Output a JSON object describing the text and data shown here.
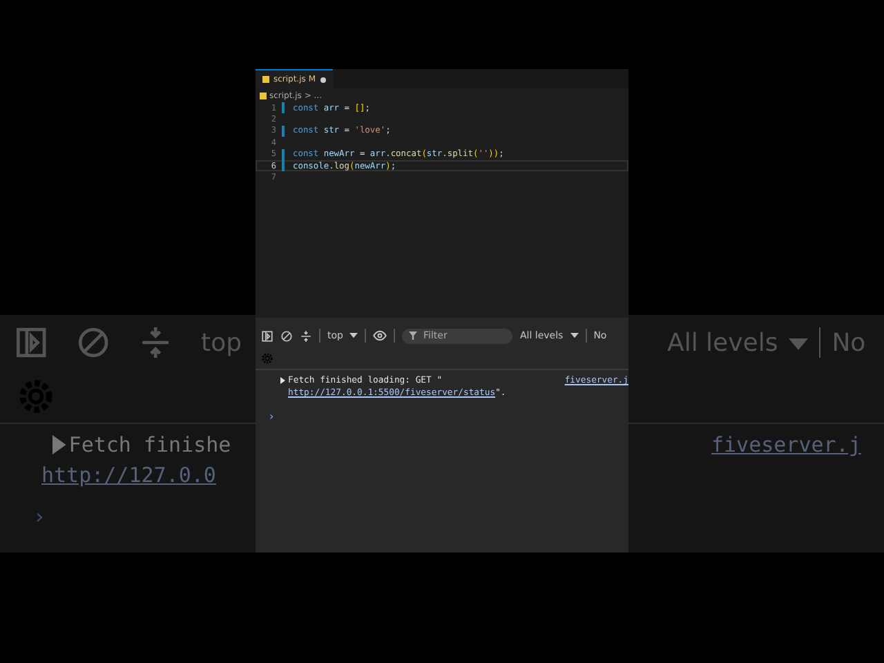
{
  "backdrop": {
    "left": {
      "context": "top",
      "message": "Fetch finishe",
      "url": "http://127.0.0",
      "prompt": "›"
    },
    "right": {
      "levels": "All levels",
      "issues": "No",
      "source": "fiveserver.j"
    }
  },
  "editor": {
    "tab": {
      "filename": "script.js",
      "status": "M",
      "modified": true
    },
    "breadcrumb": "script.js > ...",
    "lines": [
      {
        "number": "1",
        "changed": true,
        "current": false,
        "tokens": [
          {
            "kind": "keyword",
            "text": "const "
          },
          {
            "kind": "variable",
            "text": "arr"
          },
          {
            "kind": "plain",
            "text": " = "
          },
          {
            "kind": "bracket",
            "text": "[]"
          },
          {
            "kind": "plain",
            "text": ";"
          }
        ]
      },
      {
        "number": "2",
        "changed": false,
        "current": false
      },
      {
        "number": "3",
        "changed": true,
        "current": false,
        "tokens": [
          {
            "kind": "keyword",
            "text": "const "
          },
          {
            "kind": "variable",
            "text": "str"
          },
          {
            "kind": "plain",
            "text": " = "
          },
          {
            "kind": "string",
            "text": "'love'"
          },
          {
            "kind": "plain",
            "text": ";"
          }
        ]
      },
      {
        "number": "4",
        "changed": false,
        "current": false
      },
      {
        "number": "5",
        "changed": true,
        "current": false,
        "tokens": [
          {
            "kind": "keyword",
            "text": "const "
          },
          {
            "kind": "variable",
            "text": "newArr"
          },
          {
            "kind": "plain",
            "text": " = "
          },
          {
            "kind": "variable",
            "text": "arr"
          },
          {
            "kind": "plain",
            "text": "."
          },
          {
            "kind": "function",
            "text": "concat"
          },
          {
            "kind": "bracket",
            "text": "("
          },
          {
            "kind": "variable",
            "text": "str"
          },
          {
            "kind": "plain",
            "text": "."
          },
          {
            "kind": "function",
            "text": "split"
          },
          {
            "kind": "bracket",
            "text": "("
          },
          {
            "kind": "string",
            "text": "''"
          },
          {
            "kind": "bracket",
            "text": "))"
          },
          {
            "kind": "plain",
            "text": ";"
          }
        ]
      },
      {
        "number": "6",
        "changed": true,
        "current": true,
        "tokens": [
          {
            "kind": "variable",
            "text": "console"
          },
          {
            "kind": "plain",
            "text": "."
          },
          {
            "kind": "function",
            "text": "log"
          },
          {
            "kind": "bracket",
            "text": "("
          },
          {
            "kind": "variable",
            "text": "newArr"
          },
          {
            "kind": "bracket",
            "text": ")"
          },
          {
            "kind": "plain",
            "text": ";"
          }
        ]
      },
      {
        "number": "7",
        "changed": false,
        "current": false
      }
    ]
  },
  "console": {
    "context": "top",
    "filter": {
      "placeholder": "Filter"
    },
    "levels": "All levels",
    "issues": "No",
    "messages": [
      {
        "prefix": "Fetch finished loading: GET \"",
        "url": "http://127.0.0.1:5500/fiveserver/status",
        "suffix": "\".",
        "source": "fiveserver.j"
      }
    ],
    "prompt": "›"
  }
}
